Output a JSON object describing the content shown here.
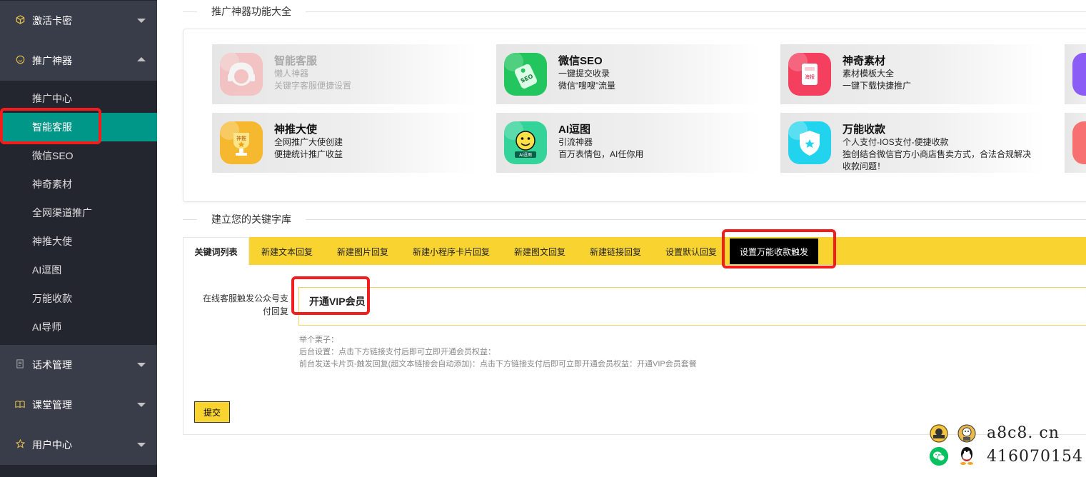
{
  "sidebar": {
    "groups": [
      {
        "label": "激活卡密",
        "icon": "cube-icon"
      },
      {
        "label": "推广神器",
        "icon": "smile-icon"
      },
      {
        "label": "话术管理",
        "icon": "document-icon"
      },
      {
        "label": "课堂管理",
        "icon": "book-icon"
      },
      {
        "label": "用户中心",
        "icon": "star-icon"
      }
    ],
    "items": [
      {
        "label": "推广中心"
      },
      {
        "label": "智能客服",
        "active": true
      },
      {
        "label": "微信SEO"
      },
      {
        "label": "神奇素材"
      },
      {
        "label": "全网渠道推广"
      },
      {
        "label": "神推大使"
      },
      {
        "label": "AI逗图"
      },
      {
        "label": "万能收款"
      },
      {
        "label": "AI导师"
      }
    ]
  },
  "features_section": {
    "title": "推广神器功能大全",
    "cards": [
      {
        "title": "智能客服",
        "line1": "懒人神器",
        "line2": "关键字客服便捷设置",
        "icon": "headset-icon",
        "color": "#fca5a5",
        "disabled": true
      },
      {
        "title": "微信SEO",
        "line1": "一键提交收录",
        "line2": "微信“嗖嗖”流量",
        "icon": "seo-tag-icon",
        "color": "#22c55e"
      },
      {
        "title": "神奇素材",
        "line1": "素材模板大全",
        "line2": "一键下载快捷推广",
        "icon": "poster-icon",
        "color": "#f43f5e",
        "icon_text": "海报"
      },
      {
        "title": "神推大使",
        "line1": "全网推广大使创建",
        "line2": "便捷统计推广收益",
        "icon": "trophy-icon",
        "color": "#f5b82e",
        "icon_text": "神推"
      },
      {
        "title": "AI逗图",
        "line1": "引流神器",
        "line2": "百万表情包，AI任你用",
        "icon": "emoji-icon",
        "color": "#34d399",
        "icon_text": "AI逗图"
      },
      {
        "title": "万能收款",
        "line1": "个人支付-IOS支付-便捷收款",
        "line2": "独创结合微信官方小商店售卖方式，合法合规解决",
        "line3": "收款问题！",
        "icon": "shield-icon",
        "color": "#22d3ee"
      }
    ]
  },
  "keyword_section": {
    "title": "建立您的关键字库",
    "tabs": [
      {
        "label": "关键词列表"
      },
      {
        "label": "新建文本回复"
      },
      {
        "label": "新建图片回复"
      },
      {
        "label": "新建小程序卡片回复"
      },
      {
        "label": "新建图文回复"
      },
      {
        "label": "新建链接回复"
      },
      {
        "label": "设置默认回复"
      },
      {
        "label": "设置万能收款触发"
      }
    ],
    "form": {
      "label": "在线客服触发公众号支付回复",
      "value": "开通VIP会员",
      "hint_title": "举个栗子：",
      "hint_backend": "后台设置：点击下方链接支付后即可立即开通会员权益：",
      "hint_frontend": "前台发送卡片页-触发回复(超文本链接会自动添加)：点击下方链接支付后即可立即开通会员权益：开通VIP会员套餐",
      "submit_label": "提交"
    }
  },
  "watermark": {
    "site": "a8c8. cn",
    "qq": "416070154"
  }
}
